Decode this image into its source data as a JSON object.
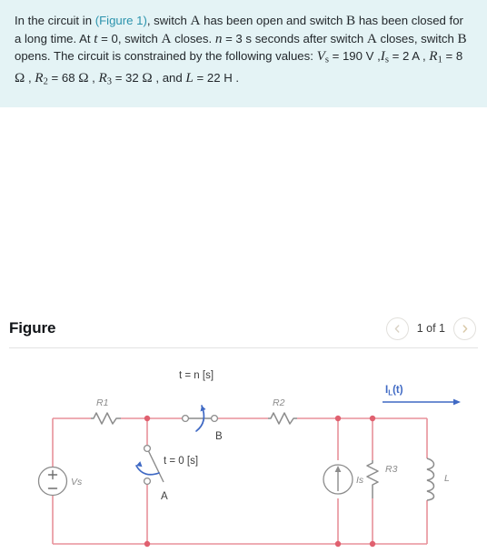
{
  "problem": {
    "line_parts": {
      "p1": "In the circuit in ",
      "figure_link": "(Figure 1)",
      "p2": ", switch ",
      "switch_a_1": "A",
      "p3": " has been open and switch ",
      "switch_b_1": "B",
      "p4": " has been closed for a long time. At ",
      "t_var": "t",
      "p5": " = 0, switch ",
      "switch_a_2": "A",
      "p6": " closes. ",
      "n_var": "n",
      "p7": " = 3 s",
      "p8": " seconds after switch ",
      "switch_a_3": "A",
      "p9": " closes, switch ",
      "switch_b_2": "B",
      "p10": " opens. The circuit is constrained by the following values: ",
      "vs_sym": "V",
      "vs_sub": "s",
      "vs_eq": " = 190 V",
      "sep1": " ,",
      "is_sym": "I",
      "is_sub": "s",
      "is_eq": " = 2 A",
      "sep2": " , ",
      "r1_sym": "R",
      "r1_sub": "1",
      "r1_eq": " = 8 ",
      "ohm1": "Ω",
      "sep3": " , ",
      "r2_sym": "R",
      "r2_sub": "2",
      "r2_eq": " = 68 ",
      "ohm2": "Ω",
      "sep4": " , ",
      "r3_sym": "R",
      "r3_sub": "3",
      "r3_eq": " = 32 ",
      "ohm3": "Ω",
      "sep5": " , and ",
      "l_sym": "L",
      "l_eq": " = 22 H",
      "period": " ."
    }
  },
  "figure": {
    "title": "Figure",
    "pager": {
      "prev_icon": "chevron-left-icon",
      "next_icon": "chevron-right-icon",
      "label": "1 of 1"
    }
  },
  "circuit": {
    "labels": {
      "r1": "R1",
      "r2": "R2",
      "r3": "R3",
      "vs": "Vs",
      "is": "Is",
      "l": "L",
      "switch_a": "A",
      "switch_b": "B",
      "t_zero": "t = 0 [s]",
      "t_n": "t = n [s]",
      "il_main": "I",
      "il_sub": "L",
      "il_tail": "(t)"
    },
    "colors": {
      "wire": "#e8919a",
      "component": "#8c8c8c",
      "node": "#e0606f",
      "annotation": "#3f69c4"
    }
  }
}
